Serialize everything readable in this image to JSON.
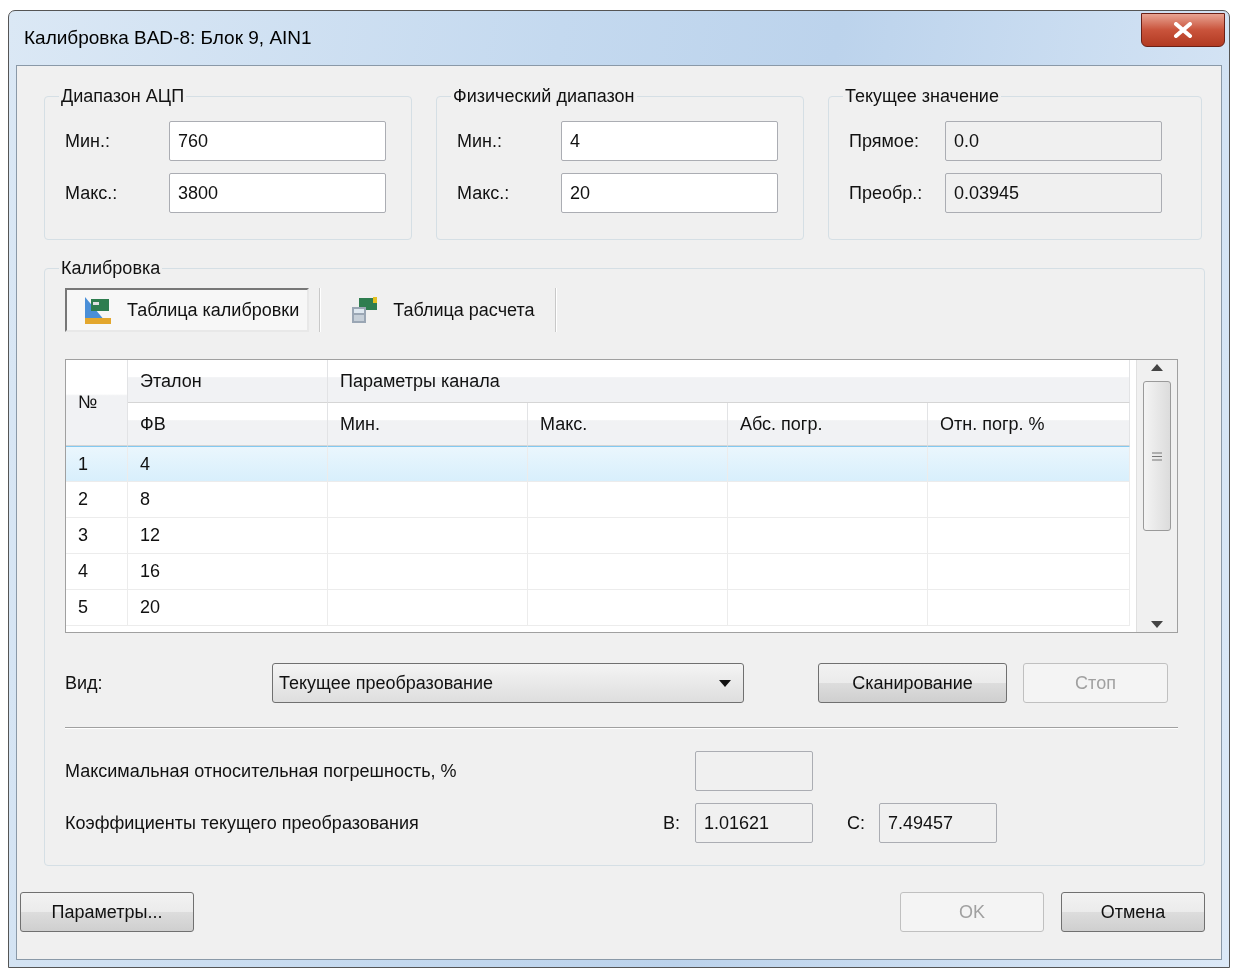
{
  "window": {
    "title": "Калибровка BAD-8: Блок 9, AIN1"
  },
  "groups": [
    {
      "legend": "Диапазон АЦП",
      "fields": [
        {
          "label": "Мин.:",
          "value": "760",
          "readonly": false
        },
        {
          "label": "Макс.:",
          "value": "3800",
          "readonly": false
        }
      ]
    },
    {
      "legend": "Физический диапазон",
      "fields": [
        {
          "label": "Мин.:",
          "value": "4",
          "readonly": false
        },
        {
          "label": "Макс.:",
          "value": "20",
          "readonly": false
        }
      ]
    },
    {
      "legend": "Текущее значение",
      "fields": [
        {
          "label": "Прямое:",
          "value": "0.0",
          "readonly": true
        },
        {
          "label": "Преобр.:",
          "value": "0.03945",
          "readonly": true
        }
      ]
    }
  ],
  "calibration": {
    "legend": "Калибровка",
    "tabs": [
      {
        "label": "Таблица калибровки",
        "selected": true
      },
      {
        "label": "Таблица расчета",
        "selected": false
      }
    ],
    "table": {
      "number_header": "№",
      "group_headers": [
        "Эталон",
        "Параметры канала"
      ],
      "columns": [
        "ФВ",
        "Мин.",
        "Макс.",
        "Абс. погр.",
        "Отн. погр. %"
      ],
      "rows": [
        {
          "no": "1",
          "fv": "4",
          "selected": true
        },
        {
          "no": "2",
          "fv": "8",
          "selected": false
        },
        {
          "no": "3",
          "fv": "12",
          "selected": false
        },
        {
          "no": "4",
          "fv": "16",
          "selected": false
        },
        {
          "no": "5",
          "fv": "20",
          "selected": false
        }
      ]
    },
    "view": {
      "label": "Вид:",
      "value": "Текущее преобразование"
    },
    "actions": [
      {
        "label": "Сканирование",
        "disabled": false
      },
      {
        "label": "Стоп",
        "disabled": true
      }
    ],
    "max_error": {
      "label": "Максимальная относительная погрешность, %"
    },
    "coefficients": {
      "label": "Коэффициенты текущего преобразования",
      "items": [
        {
          "label": "B:",
          "value": "1.01621"
        },
        {
          "label": "C:",
          "value": "7.49457"
        }
      ]
    }
  },
  "footer": {
    "left": {
      "label": "Параметры...",
      "disabled": false
    },
    "right": [
      {
        "label": "OK",
        "disabled": true
      },
      {
        "label": "Отмена",
        "disabled": false
      }
    ]
  }
}
